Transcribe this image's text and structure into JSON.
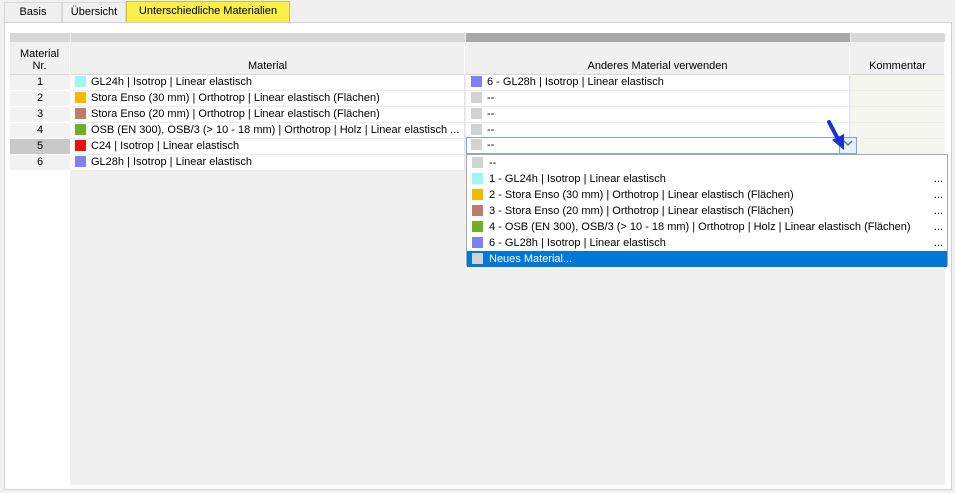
{
  "tabs": [
    {
      "label": "Basis"
    },
    {
      "label": "Übersicht"
    },
    {
      "label": "Unterschiedliche Materialien"
    }
  ],
  "headers": {
    "nr_line1": "Material",
    "nr_line2": "Nr.",
    "material": "Material",
    "alt": "Anderes Material verwenden",
    "kommentar": "Kommentar"
  },
  "colors": {
    "cyan": "#9ff5f5",
    "orange": "#f5b800",
    "rose": "#bd7b72",
    "green": "#6eb023",
    "red": "#ee1010",
    "blue": "#8080f2",
    "gray": "#d2d2d2",
    "accent": "#0078d7",
    "tab_active": "#f8ef4a"
  },
  "rows": [
    {
      "nr": "1",
      "material": "GL24h | Isotrop | Linear elastisch",
      "alt": "6 - GL28h | Isotrop | Linear elastisch"
    },
    {
      "nr": "2",
      "material": "Stora Enso (30 mm) | Orthotrop | Linear elastisch (Flächen)",
      "alt": "--"
    },
    {
      "nr": "3",
      "material": "Stora Enso (20 mm) | Orthotrop | Linear elastisch (Flächen)",
      "alt": "--"
    },
    {
      "nr": "4",
      "material": "OSB (EN 300), OSB/3 (> 10 - 18 mm) | Orthotrop | Holz | Linear elastisch ...",
      "alt": "--"
    },
    {
      "nr": "5",
      "material": "C24 | Isotrop | Linear elastisch",
      "alt": "--"
    },
    {
      "nr": "6",
      "material": "GL28h | Isotrop | Linear elastisch",
      "alt": ""
    }
  ],
  "combo": {
    "value": "--",
    "arrow_icon": "chevron-down-icon"
  },
  "dropdown": [
    {
      "label": "--",
      "dots": ""
    },
    {
      "label": "1 - GL24h | Isotrop | Linear elastisch",
      "dots": "..."
    },
    {
      "label": "2 - Stora Enso (30 mm) | Orthotrop | Linear elastisch (Flächen)",
      "dots": "..."
    },
    {
      "label": "3 - Stora Enso (20 mm) | Orthotrop | Linear elastisch (Flächen)",
      "dots": "..."
    },
    {
      "label": "4 - OSB (EN 300), OSB/3 (> 10 - 18 mm) | Orthotrop | Holz | Linear elastisch (Flächen)",
      "dots": "..."
    },
    {
      "label": "6 - GL28h | Isotrop | Linear elastisch",
      "dots": "..."
    },
    {
      "label": "Neues Material...",
      "dots": ""
    }
  ]
}
